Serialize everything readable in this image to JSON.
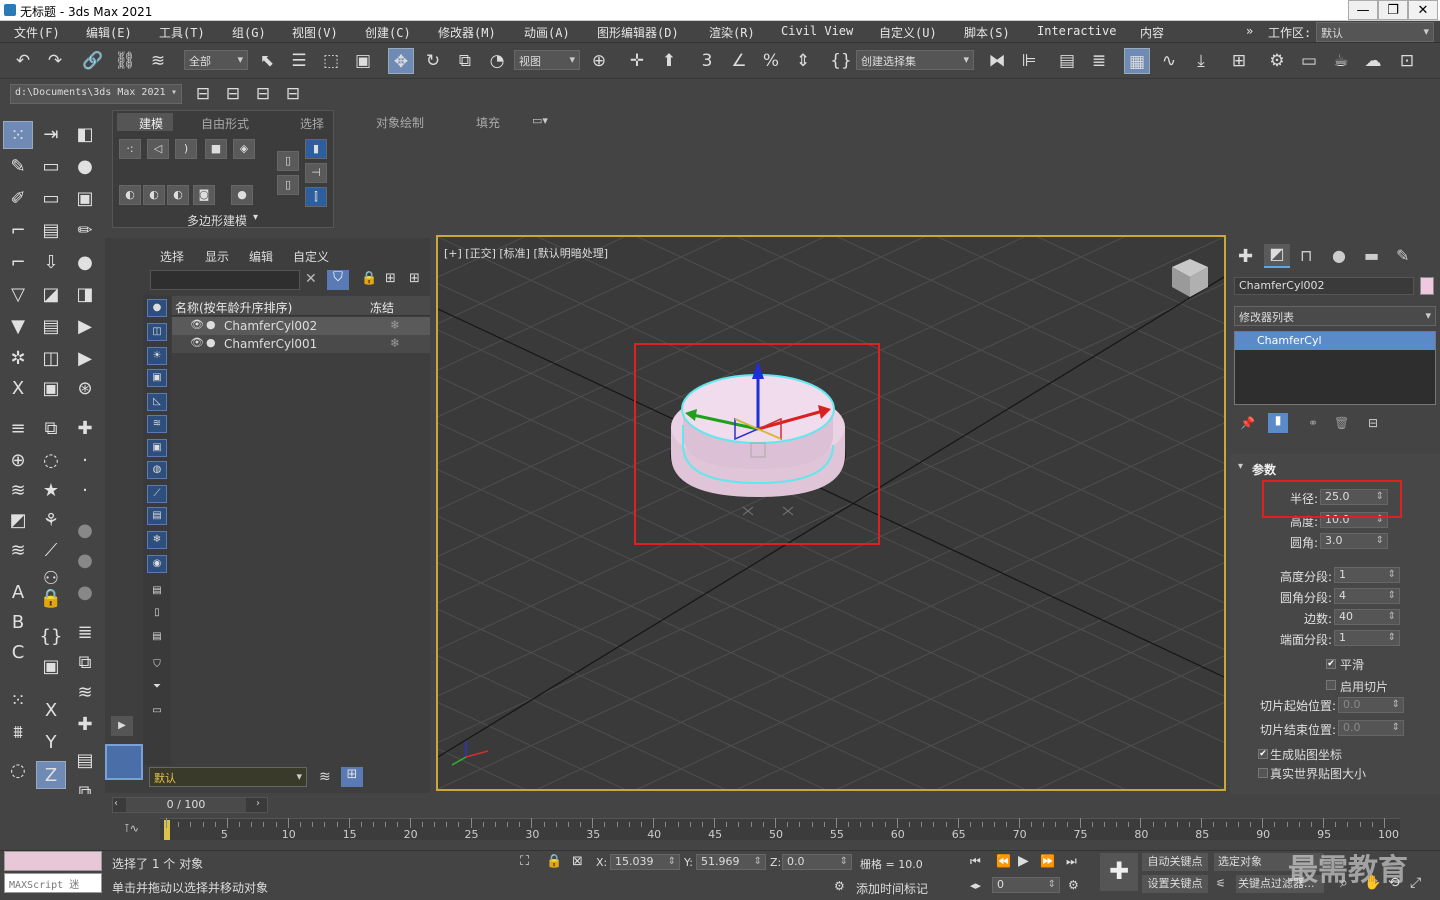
{
  "window": {
    "title": "无标题 - 3ds Max 2021",
    "minimize": "—",
    "restore": "❐",
    "close": "✕"
  },
  "menu": [
    "文件(F)",
    "编辑(E)",
    "工具(T)",
    "组(G)",
    "视图(V)",
    "创建(C)",
    "修改器(M)",
    "动画(A)",
    "图形编辑器(D)",
    "渲染(R)",
    "Civil View",
    "自定义(U)",
    "脚本(S)",
    "Interactive",
    "内容"
  ],
  "workspace": {
    "label": "工作区:",
    "value": "默认"
  },
  "toolbar": {
    "filter": "全部",
    "ref_coord": "视图",
    "selection_set": "创建选择集"
  },
  "path": {
    "value": "d:\\Documents\\3ds Max 2021"
  },
  "ribbon": {
    "tabs": [
      "建模",
      "自由形式",
      "选择",
      "对象绘制",
      "填充"
    ],
    "footer": "多边形建模"
  },
  "scene": {
    "menus": [
      "选择",
      "显示",
      "编辑",
      "自定义"
    ],
    "col_name": "名称(按年龄升序排序)",
    "col_freeze": "冻结",
    "objects": [
      {
        "name": "ChamferCyl002",
        "selected": true
      },
      {
        "name": "ChamferCyl001",
        "selected": false
      }
    ],
    "layer": "默认"
  },
  "viewport": {
    "label": "[+] [正交] [标准] [默认明暗处理]"
  },
  "command": {
    "object_name": "ChamferCyl002",
    "modifier_list": "修改器列表",
    "stack_item": "ChamferCyl",
    "rollout": "参数",
    "params": [
      {
        "label": "半径:",
        "value": "25.0"
      },
      {
        "label": "高度:",
        "value": "10.0"
      },
      {
        "label": "圆角:",
        "value": "3.0"
      }
    ],
    "segs": [
      {
        "label": "高度分段:",
        "value": "1"
      },
      {
        "label": "圆角分段:",
        "value": "4"
      },
      {
        "label": "边数:",
        "value": "40"
      },
      {
        "label": "端面分段:",
        "value": "1"
      }
    ],
    "smooth": "平滑",
    "slice_on": "启用切片",
    "slice_from": {
      "label": "切片起始位置:",
      "value": "0.0"
    },
    "slice_to": {
      "label": "切片结束位置:",
      "value": "0.0"
    },
    "gen_map": "生成贴图坐标",
    "real_world": "真实世界贴图大小"
  },
  "timeline": {
    "frame": "0 / 100",
    "ticks": [
      "0",
      "5",
      "10",
      "15",
      "20",
      "25",
      "30",
      "35",
      "40",
      "45",
      "50",
      "55",
      "60",
      "65",
      "70",
      "75",
      "80",
      "85",
      "90",
      "95",
      "100"
    ]
  },
  "status": {
    "selected": "选择了 1 个 对象",
    "hint": "单击并拖动以选择并移动对象",
    "maxscript": "MAXScript 迷",
    "x_label": "X:",
    "x": "15.039",
    "y_label": "Y:",
    "y": "51.969",
    "z_label": "Z:",
    "z": "0.0",
    "grid": "栅格 = 10.0",
    "add_tag": "添加时间标记",
    "auto_key": "自动关键点",
    "set_key": "设置关键点",
    "sel_obj": "选定对象",
    "key_filter": "关键点过滤器...",
    "frame_field": "0",
    "watermark": "最需教育"
  }
}
